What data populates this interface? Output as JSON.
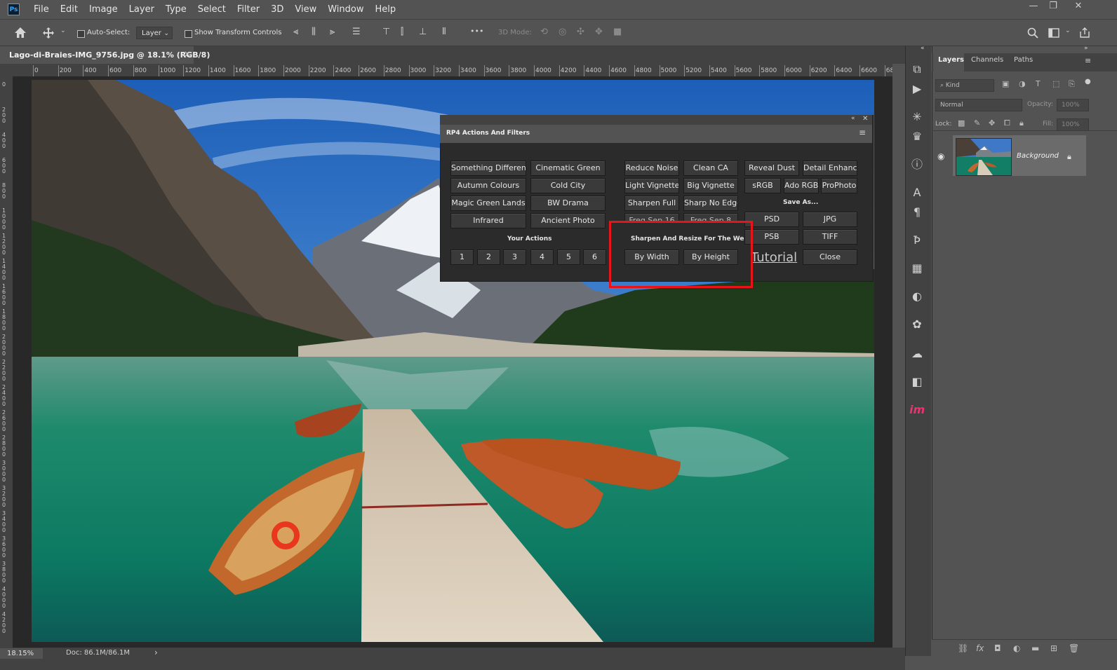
{
  "app": {
    "logo_text": "Ps"
  },
  "menu": [
    "File",
    "Edit",
    "Image",
    "Layer",
    "Type",
    "Select",
    "Filter",
    "3D",
    "View",
    "Window",
    "Help"
  ],
  "window_controls": {
    "minimize": "—",
    "restore": "❐",
    "close": "✕"
  },
  "options_bar": {
    "auto_select_label": "Auto-Select:",
    "auto_select_target": "Layer",
    "show_transform_label": "Show Transform Controls",
    "mode_3d_label": "3D Mode:",
    "more_label": "•••"
  },
  "document_tab": {
    "title": "Lago-di-Braies-IMG_9756.jpg @ 18.1% (RGB/8)",
    "close": "×"
  },
  "ruler": {
    "h_ticks": [
      "0",
      "200",
      "400",
      "600",
      "800",
      "1000",
      "1200",
      "1400",
      "1600",
      "1800",
      "2000",
      "2200",
      "2400",
      "2600",
      "2800",
      "3000",
      "3200",
      "3400",
      "3600",
      "3800",
      "4000",
      "4200",
      "4400",
      "4600",
      "4800",
      "5000",
      "5200",
      "5400",
      "5600",
      "5800",
      "6000",
      "6200",
      "6400",
      "6600",
      "68"
    ],
    "v_ticks": [
      "0",
      "200",
      "400",
      "600",
      "800",
      "1000",
      "1200",
      "1400",
      "1600",
      "1800",
      "2000",
      "2200",
      "2400",
      "2600",
      "2800",
      "3000",
      "3200",
      "3400",
      "3600",
      "3800",
      "4000",
      "4200"
    ]
  },
  "status": {
    "zoom": "18.15%",
    "doc": "Doc: 86.1M/86.1M",
    "arrow": "›"
  },
  "panels": {
    "tabs": [
      "Layers",
      "Channels",
      "Paths"
    ],
    "kind_placeholder": "Kind",
    "blend_mode": "Normal",
    "opacity_label": "Opacity:",
    "opacity_value": "100%",
    "lock_label": "Lock:",
    "fill_label": "Fill:",
    "fill_value": "100%",
    "layer_name": "Background"
  },
  "rp4_panel": {
    "title": "RP4 Actions And Filters",
    "col1": [
      "Something Different",
      "Autumn Colours",
      "Magic Green Lands",
      "Infrared"
    ],
    "col2": [
      "Cinematic Green",
      "Cold City",
      "BW Drama",
      "Ancient Photo"
    ],
    "your_actions_label": "Your Actions",
    "your_actions": [
      "1",
      "2",
      "3",
      "4",
      "5",
      "6"
    ],
    "col3": [
      "Reduce Noise",
      "Light Vignette",
      "Sharpen Full",
      "Freq Sep 16"
    ],
    "col4": [
      "Clean CA",
      "Big Vignette",
      "Sharp No Edge",
      "Freq Sep 8"
    ],
    "sharpen_label": "Sharpen And Resize For The Web",
    "by_width": "By Width",
    "by_height": "By Height",
    "col5": [
      "Reveal Dust",
      "sRGB"
    ],
    "detail_enhance": "Detail Enhance",
    "ado_rgb": "Ado RGB",
    "prophoto": "ProPhoto",
    "save_as_label": "Save As...",
    "save_buttons": [
      "PSD",
      "JPG",
      "PSB",
      "TIFF"
    ],
    "tutorial": "Tutorial",
    "close": "Close"
  },
  "colors": {
    "highlight": "#e8141a",
    "accent": "#31a8ff"
  }
}
